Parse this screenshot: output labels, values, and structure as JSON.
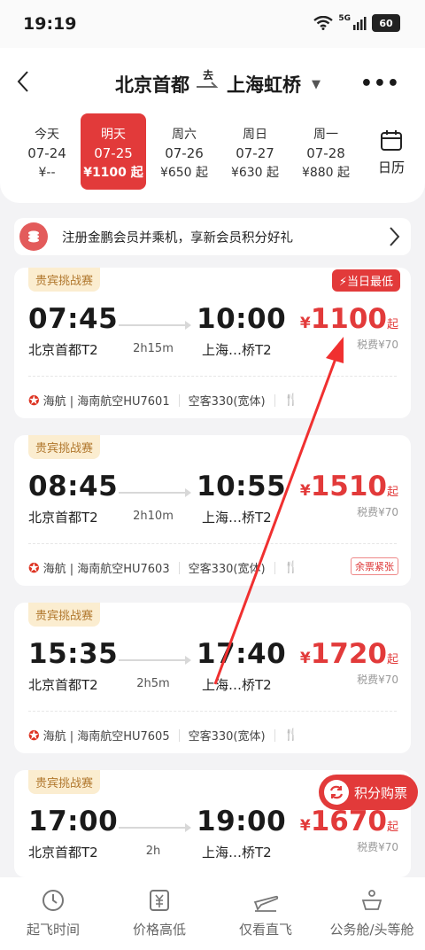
{
  "status": {
    "time": "19:19",
    "network": "5G",
    "battery": "60"
  },
  "route": {
    "from": "北京首都",
    "direction": "去",
    "to": "上海虹桥"
  },
  "dates": [
    {
      "week": "今天",
      "date": "07-24",
      "price": "¥--"
    },
    {
      "week": "明天",
      "date": "07-25",
      "price": "¥1100 起",
      "active": true
    },
    {
      "week": "周六",
      "date": "07-26",
      "price": "¥650 起"
    },
    {
      "week": "周日",
      "date": "07-27",
      "price": "¥630 起"
    },
    {
      "week": "周一",
      "date": "07-28",
      "price": "¥880 起"
    }
  ],
  "calendar_label": "日历",
  "promo": {
    "text": "注册金鹏会员并乘机，享新会员积分好礼"
  },
  "flights": [
    {
      "tag": "贵宾挑战赛",
      "badge": "当日最低",
      "dep_time": "07:45",
      "arr_time": "10:00",
      "dep_airport": "北京首都T2",
      "arr_airport": "上海…桥T2",
      "duration": "2h15m",
      "currency": "¥",
      "price": "1100",
      "price_suffix": "起",
      "tax": "税费¥70",
      "airline": "海航 | 海南航空HU7601",
      "aircraft": "空客330(宽体)",
      "note": ""
    },
    {
      "tag": "贵宾挑战赛",
      "badge": "",
      "dep_time": "08:45",
      "arr_time": "10:55",
      "dep_airport": "北京首都T2",
      "arr_airport": "上海…桥T2",
      "duration": "2h10m",
      "currency": "¥",
      "price": "1510",
      "price_suffix": "起",
      "tax": "税费¥70",
      "airline": "海航 | 海南航空HU7603",
      "aircraft": "空客330(宽体)",
      "note": "余票紧张"
    },
    {
      "tag": "贵宾挑战赛",
      "badge": "",
      "dep_time": "15:35",
      "arr_time": "17:40",
      "dep_airport": "北京首都T2",
      "arr_airport": "上海…桥T2",
      "duration": "2h5m",
      "currency": "¥",
      "price": "1720",
      "price_suffix": "起",
      "tax": "税费¥70",
      "airline": "海航 | 海南航空HU7605",
      "aircraft": "空客330(宽体)",
      "note": ""
    },
    {
      "tag": "贵宾挑战赛",
      "badge": "",
      "dep_time": "17:00",
      "arr_time": "19:00",
      "dep_airport": "北京首都T2",
      "arr_airport": "上海…桥T2",
      "duration": "2h",
      "currency": "¥",
      "price": "1670",
      "price_suffix": "起",
      "tax": "税费¥70",
      "airline": "",
      "aircraft": "",
      "note": ""
    }
  ],
  "points_button": "积分购票",
  "bottom_tabs": [
    {
      "label": "起飞时间",
      "icon": "clock-icon"
    },
    {
      "label": "价格高低",
      "icon": "yuan-icon"
    },
    {
      "label": "仅看直飞",
      "icon": "plane-icon"
    },
    {
      "label": "公务舱/头等舱",
      "icon": "crown-icon"
    }
  ],
  "colors": {
    "accent": "#e23a3a",
    "tag_bg": "#fbedd0",
    "tag_text": "#b1782e"
  }
}
